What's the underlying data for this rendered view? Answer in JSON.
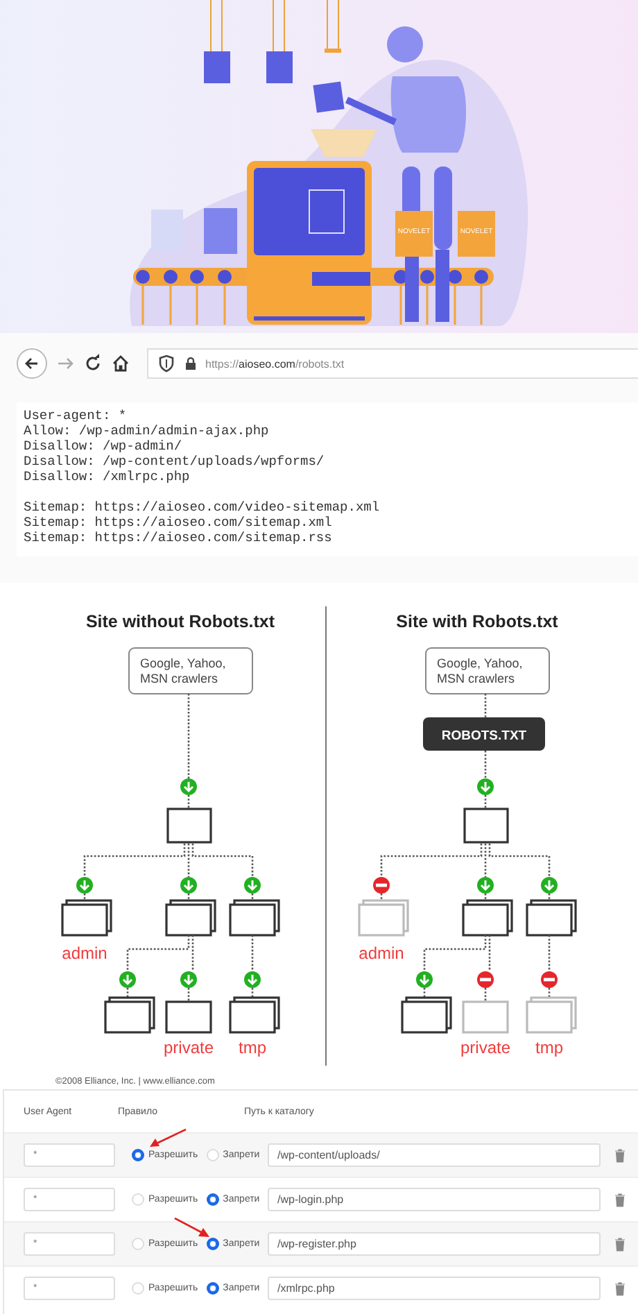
{
  "illustration": {
    "box_labels": [
      "NOVELET",
      "NOVELET"
    ]
  },
  "browser": {
    "url": "https://**aioseo.com**/robots.txt"
  },
  "robots_file": {
    "blocks": [
      [
        "User-agent: *",
        "Allow: /wp-admin/admin-ajax.php",
        "Disallow: /wp-admin/",
        "Disallow: /wp-content/uploads/wpforms/",
        "Disallow: /xmlrpc.php"
      ],
      [
        "Sitemap: https://aioseo.com/video-sitemap.xml",
        "Sitemap: https://aioseo.com/sitemap.xml",
        "Sitemap: https://aioseo.com/sitemap.rss"
      ]
    ]
  },
  "diagrams": [
    {
      "title": "Site without Robots.txt",
      "crawler_lines": [
        "Google, Yahoo,",
        "MSN crawlers"
      ],
      "root": {
        "allowed": true,
        "children": [
          {
            "label": "admin",
            "allowed": true,
            "stacked": true
          },
          {
            "allowed": true,
            "stacked": true,
            "children": [
              {
                "allowed": true,
                "stacked": true
              },
              {
                "label": "private",
                "allowed": true,
                "stacked": false
              }
            ]
          },
          {
            "allowed": true,
            "stacked": true,
            "children": [
              {
                "label": "tmp",
                "allowed": true,
                "stacked": true
              }
            ]
          }
        ]
      }
    },
    {
      "title": "Site with Robots.txt",
      "crawler_lines": [
        "Google, Yahoo,",
        "MSN crawlers"
      ],
      "filter": "ROBOTS.TXT",
      "root": {
        "allowed": true,
        "children": [
          {
            "label": "admin",
            "allowed": false,
            "stacked": true
          },
          {
            "allowed": true,
            "stacked": true,
            "children": [
              {
                "allowed": true,
                "stacked": true
              },
              {
                "label": "private",
                "allowed": false,
                "stacked": false
              }
            ]
          },
          {
            "allowed": true,
            "stacked": true,
            "children": [
              {
                "label": "tmp",
                "allowed": false,
                "stacked": true
              }
            ]
          }
        ]
      }
    }
  ],
  "diagram_credit": "©2008 Elliance, Inc.   |   www.elliance.com",
  "rules_table": {
    "columns": [
      "User Agent",
      "Правило",
      "Путь к каталогу"
    ],
    "rows": [
      {
        "user_agent": "*",
        "options": [
          {
            "label": "Разрешить",
            "selected": true
          },
          {
            "label": "Запрети",
            "selected": false
          }
        ],
        "path": "/wp-content/uploads/",
        "annotated": true
      },
      {
        "user_agent": "*",
        "options": [
          {
            "label": "Разрешить",
            "selected": false
          },
          {
            "label": "Запрети",
            "selected": true
          }
        ],
        "path": "/wp-login.php",
        "annotated": false
      },
      {
        "user_agent": "*",
        "options": [
          {
            "label": "Разрешить",
            "selected": false
          },
          {
            "label": "Запрети",
            "selected": true
          }
        ],
        "path": "/wp-register.php",
        "annotated": true
      },
      {
        "user_agent": "*",
        "options": [
          {
            "label": "Разрешить",
            "selected": false
          },
          {
            "label": "Запрети",
            "selected": true
          }
        ],
        "path": "/xmlrpc.php",
        "annotated": false
      }
    ]
  }
}
